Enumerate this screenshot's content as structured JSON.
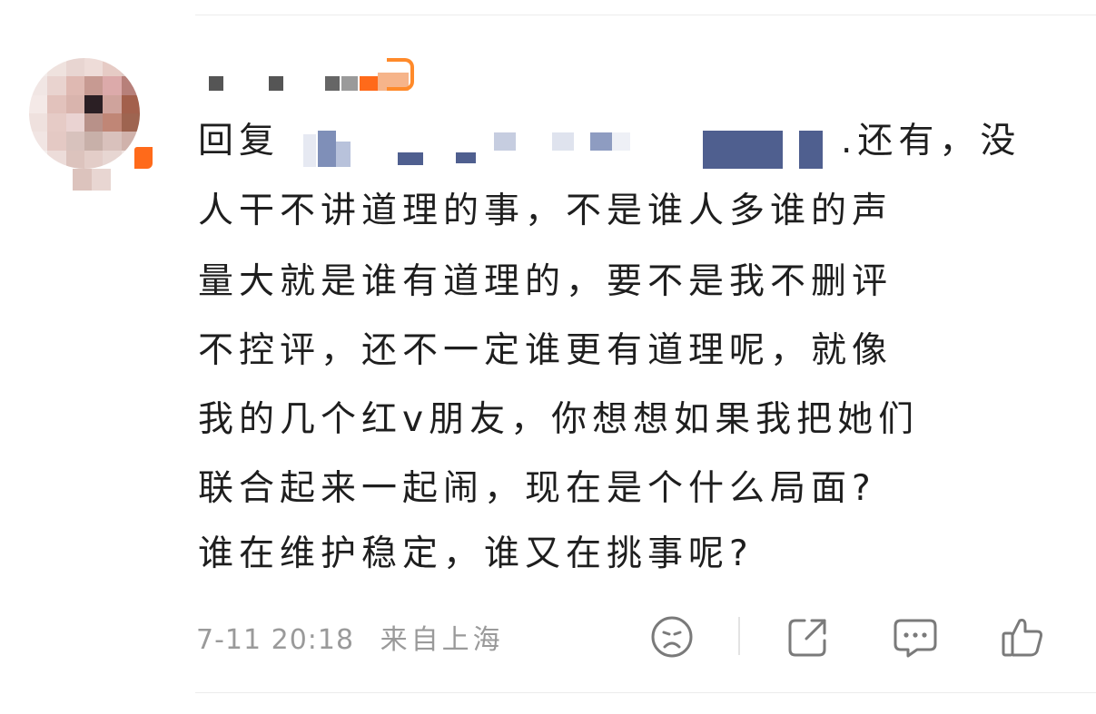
{
  "comment": {
    "reply_prefix": "回复",
    "reply_tail": ".还有，没",
    "body_lines": [
      "人干不讲道理的事，不是谁人多谁的声",
      "量大就是谁有道理的，要不是我不删评",
      "不控评，还不一定谁更有道理呢，就像",
      "我的几个红v朋友，你想想如果我把她们",
      "联合起来一起闹，现在是个什么局面?",
      "谁在维护稳定，谁又在挑事呢?"
    ],
    "time": "7-11 20:18",
    "location": "来自上海"
  },
  "colors": {
    "text": "#1e1e1e",
    "meta": "#9a9a9a",
    "icon": "#7a7a7a",
    "badge": "#ff6a1a",
    "mention": "#4f5f8f"
  },
  "icons": {
    "dislike": "sad-face-icon",
    "share": "share-icon",
    "comment": "comment-icon",
    "like": "thumbs-up-icon"
  }
}
